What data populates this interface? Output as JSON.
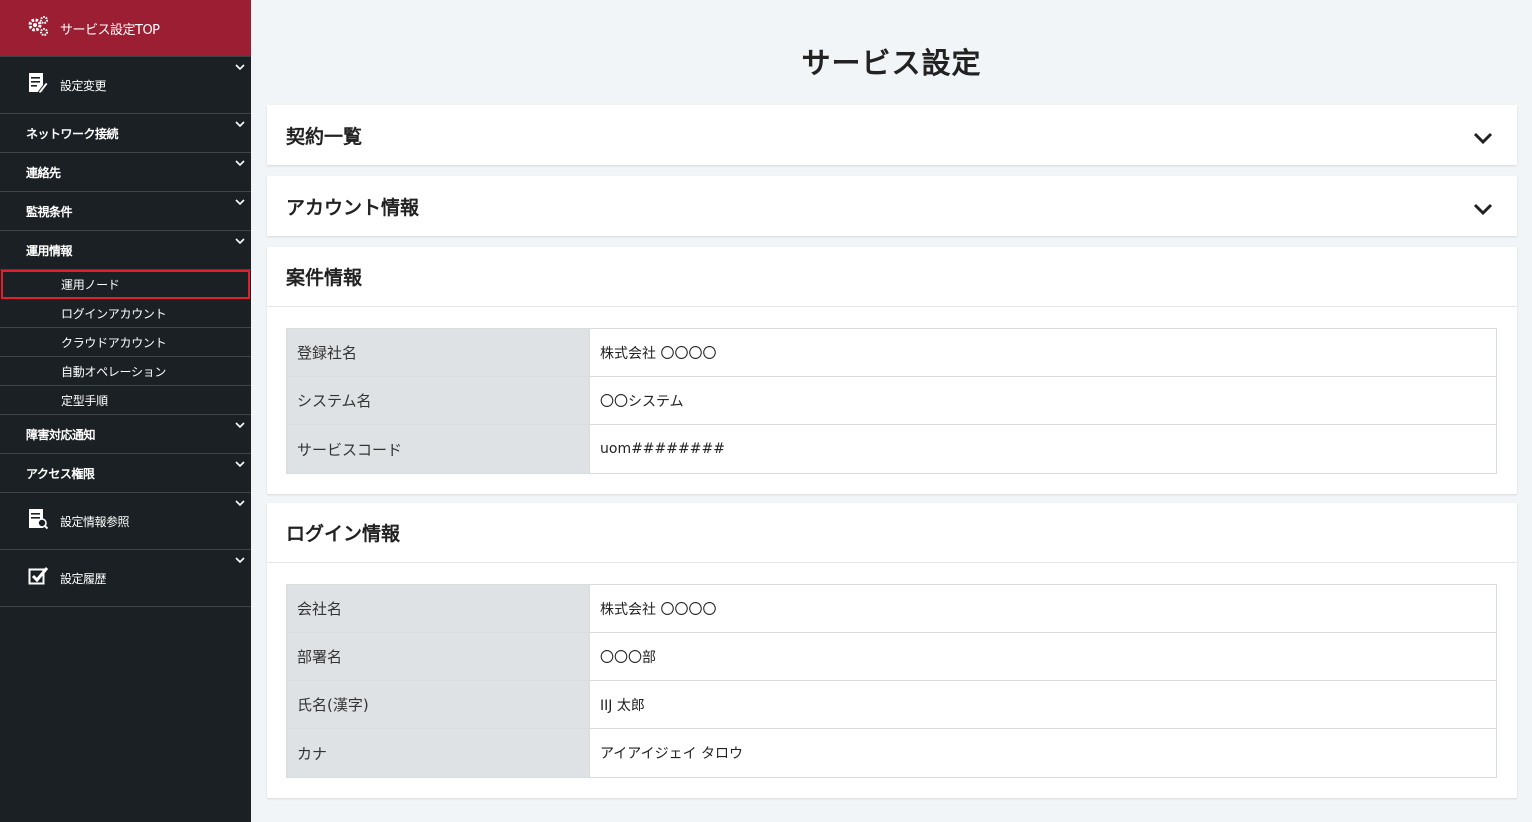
{
  "sidebar": {
    "top_label": "サービス設定TOP",
    "sections": {
      "settings_change": "設定変更",
      "network": "ネットワーク接続",
      "contacts": "連絡先",
      "monitoring": "監視条件",
      "operations": "運用情報",
      "operations_items": [
        "運用ノード",
        "ログインアカウント",
        "クラウドアカウント",
        "自動オペレーション",
        "定型手順"
      ],
      "incident": "障害対応通知",
      "access": "アクセス権限",
      "settings_ref": "設定情報参照",
      "history": "設定履歴"
    },
    "accent_color": "#9b1e32",
    "selected_outline_color": "#e0202c"
  },
  "main": {
    "title": "サービス設定",
    "contracts": {
      "title": "契約一覧"
    },
    "account": {
      "title": "アカウント情報"
    },
    "case": {
      "title": "案件情報",
      "rows": [
        {
          "key": "登録社名",
          "value": "株式会社 〇〇〇〇"
        },
        {
          "key": "システム名",
          "value": "〇〇システム"
        },
        {
          "key": "サービスコード",
          "value": "uom########"
        }
      ]
    },
    "login": {
      "title": "ログイン情報",
      "rows": [
        {
          "key": "会社名",
          "value": "株式会社 〇〇〇〇"
        },
        {
          "key": "部署名",
          "value": "〇〇〇部"
        },
        {
          "key": "氏名(漢字)",
          "value": "IIJ 太郎"
        },
        {
          "key": "カナ",
          "value": "アイアイジェイ タロウ"
        }
      ]
    }
  }
}
